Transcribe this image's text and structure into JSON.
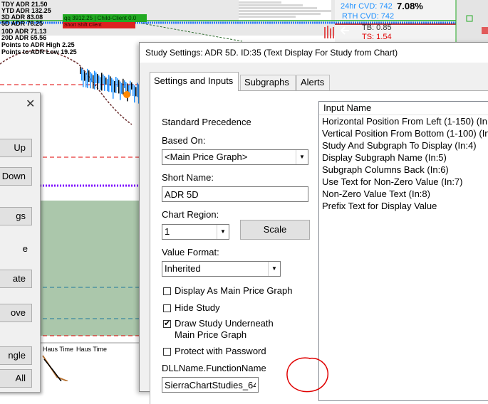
{
  "chart": {
    "stats": [
      "TDY ADR 21.50",
      "YTD ADR 132.25",
      "3D ADR 83.08",
      "5D ADR 78.25",
      "10D ADR 71.13",
      "20D ADR 65.56",
      "Points to ADR High 2.25",
      "Points to ADR Low 19.25"
    ],
    "green_bar_text": "qq 3912.25 | Child-Client 0.0",
    "red_bar_text": "Short Shift Client",
    "cvd_24hr": "24hr CVD: 742",
    "cvd_rth": "RTH CVD: 742",
    "percent_change": "7.08%",
    "tb": "TB: 0.85",
    "ts": "TS: 1.54",
    "haus_time_1": "Haus Time",
    "haus_time_2": "Haus Time",
    "colors": {
      "up": "#1e90ff",
      "down": "#000000",
      "accent_red": "#e00000",
      "accent_green": "#22aa22",
      "purple": "#7b00ff"
    }
  },
  "left_panel": {
    "up_label": "Up",
    "down_label": "Down",
    "gs_label": "gs",
    "e_label": "e",
    "ate_label": "ate",
    "ove_label": "ove",
    "ngle_label": "ngle",
    "all_label": "All"
  },
  "dialog": {
    "title": "Study Settings: ADR 5D. ID:35 (Text Display For Study from Chart)",
    "tabs": [
      {
        "label": "Settings and Inputs",
        "active": true
      },
      {
        "label": "Subgraphs",
        "active": false
      },
      {
        "label": "Alerts",
        "active": false
      }
    ],
    "standard_precedence_label": "Standard Precedence",
    "based_on_label": "Based On:",
    "based_on_value": "<Main Price Graph>",
    "short_name_label": "Short Name:",
    "short_name_value": "ADR 5D",
    "chart_region_label": "Chart Region:",
    "chart_region_value": "1",
    "scale_button": "Scale",
    "value_format_label": "Value Format:",
    "value_format_value": "Inherited",
    "checkboxes": [
      {
        "label": "Display As Main Price Graph",
        "checked": false
      },
      {
        "label": "Hide Study",
        "checked": false
      },
      {
        "label": "Draw Study Underneath Main Price Graph",
        "checked": true
      },
      {
        "label": "Protect with Password",
        "checked": false
      }
    ],
    "dll_label": "DLLName.FunctionName",
    "dll_value": "SierraChartStudies_64.",
    "input_list_header": "Input Name",
    "input_list": [
      "Horizontal Position From Left (1-150)  (In",
      "Vertical Position From Bottom (1-100)  (In",
      "Study And Subgraph To Display  (In:4)",
      "Display Subgraph Name  (In:5)",
      "Subgraph Columns Back  (In:6)",
      "Use Text for Non-Zero Value  (In:7)",
      "Non-Zero Value Text  (In:8)",
      "Prefix Text for Display Value"
    ],
    "annotation_color": "#e00000"
  }
}
